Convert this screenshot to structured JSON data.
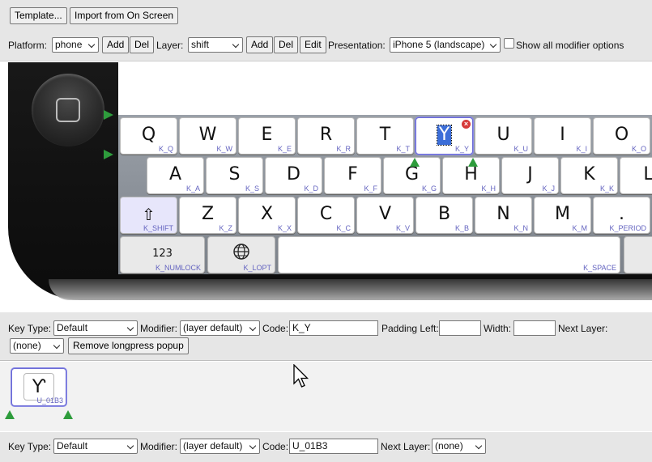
{
  "toolbar": {
    "template_label": "Template...",
    "import_label": "Import from On Screen",
    "platform_label": "Platform:",
    "platform_value": "phone",
    "add_label": "Add",
    "del_label": "Del",
    "layer_label": "Layer:",
    "layer_value": "shift",
    "edit_label": "Edit",
    "presentation_label": "Presentation:",
    "presentation_value": "iPhone 5 (landscape)",
    "show_all_label": "Show all modifier options"
  },
  "keyboard": {
    "row1": [
      {
        "cap": "Q",
        "id": "K_Q"
      },
      {
        "cap": "W",
        "id": "K_W"
      },
      {
        "cap": "E",
        "id": "K_E"
      },
      {
        "cap": "R",
        "id": "K_R"
      },
      {
        "cap": "T",
        "id": "K_T"
      },
      {
        "cap": "Y",
        "id": "K_Y"
      },
      {
        "cap": "U",
        "id": "K_U"
      },
      {
        "cap": "I",
        "id": "K_I"
      },
      {
        "cap": "O",
        "id": "K_O"
      }
    ],
    "row2": [
      {
        "cap": "A",
        "id": "K_A"
      },
      {
        "cap": "S",
        "id": "K_S"
      },
      {
        "cap": "D",
        "id": "K_D"
      },
      {
        "cap": "F",
        "id": "K_F"
      },
      {
        "cap": "G",
        "id": "K_G"
      },
      {
        "cap": "H",
        "id": "K_H"
      },
      {
        "cap": "J",
        "id": "K_J"
      },
      {
        "cap": "K",
        "id": "K_K"
      },
      {
        "cap": "L",
        "id": ""
      }
    ],
    "row3": [
      {
        "cap": "⇧",
        "id": "K_SHIFT"
      },
      {
        "cap": "Z",
        "id": "K_Z"
      },
      {
        "cap": "X",
        "id": "K_X"
      },
      {
        "cap": "C",
        "id": "K_C"
      },
      {
        "cap": "V",
        "id": "K_V"
      },
      {
        "cap": "B",
        "id": "K_B"
      },
      {
        "cap": "N",
        "id": "K_N"
      },
      {
        "cap": "M",
        "id": "K_M"
      },
      {
        "cap": ".",
        "id": "K_PERIOD"
      }
    ],
    "row4": [
      {
        "cap": "123",
        "id": "K_NUMLOCK"
      },
      {
        "cap": "globe-icon",
        "id": "K_LOPT"
      },
      {
        "cap": "",
        "id": "K_SPACE"
      }
    ]
  },
  "key_props": {
    "key_type_label": "Key Type:",
    "key_type_value": "Default",
    "modifier_label": "Modifier:",
    "modifier_value": "(layer default)",
    "code_label": "Code:",
    "code_value": "K_Y",
    "padding_left_label": "Padding Left:",
    "padding_left_value": "",
    "width_label": "Width:",
    "width_value": "",
    "next_layer_label": "Next Layer:",
    "next_layer_value": "(none)",
    "remove_longpress_label": "Remove longpress popup"
  },
  "longpress": {
    "cap": "Ƴ",
    "id": "U_01B3"
  },
  "sub_props": {
    "key_type_label": "Key Type:",
    "key_type_value": "Default",
    "modifier_label": "Modifier:",
    "modifier_value": "(layer default)",
    "code_label": "Code:",
    "code_value": "U_01B3",
    "next_layer_label": "Next Layer:",
    "next_layer_value": "(none)"
  },
  "colors": {
    "accent": "#6b6bd6",
    "marker": "#2e9c3c",
    "delete": "#d63a3a"
  }
}
